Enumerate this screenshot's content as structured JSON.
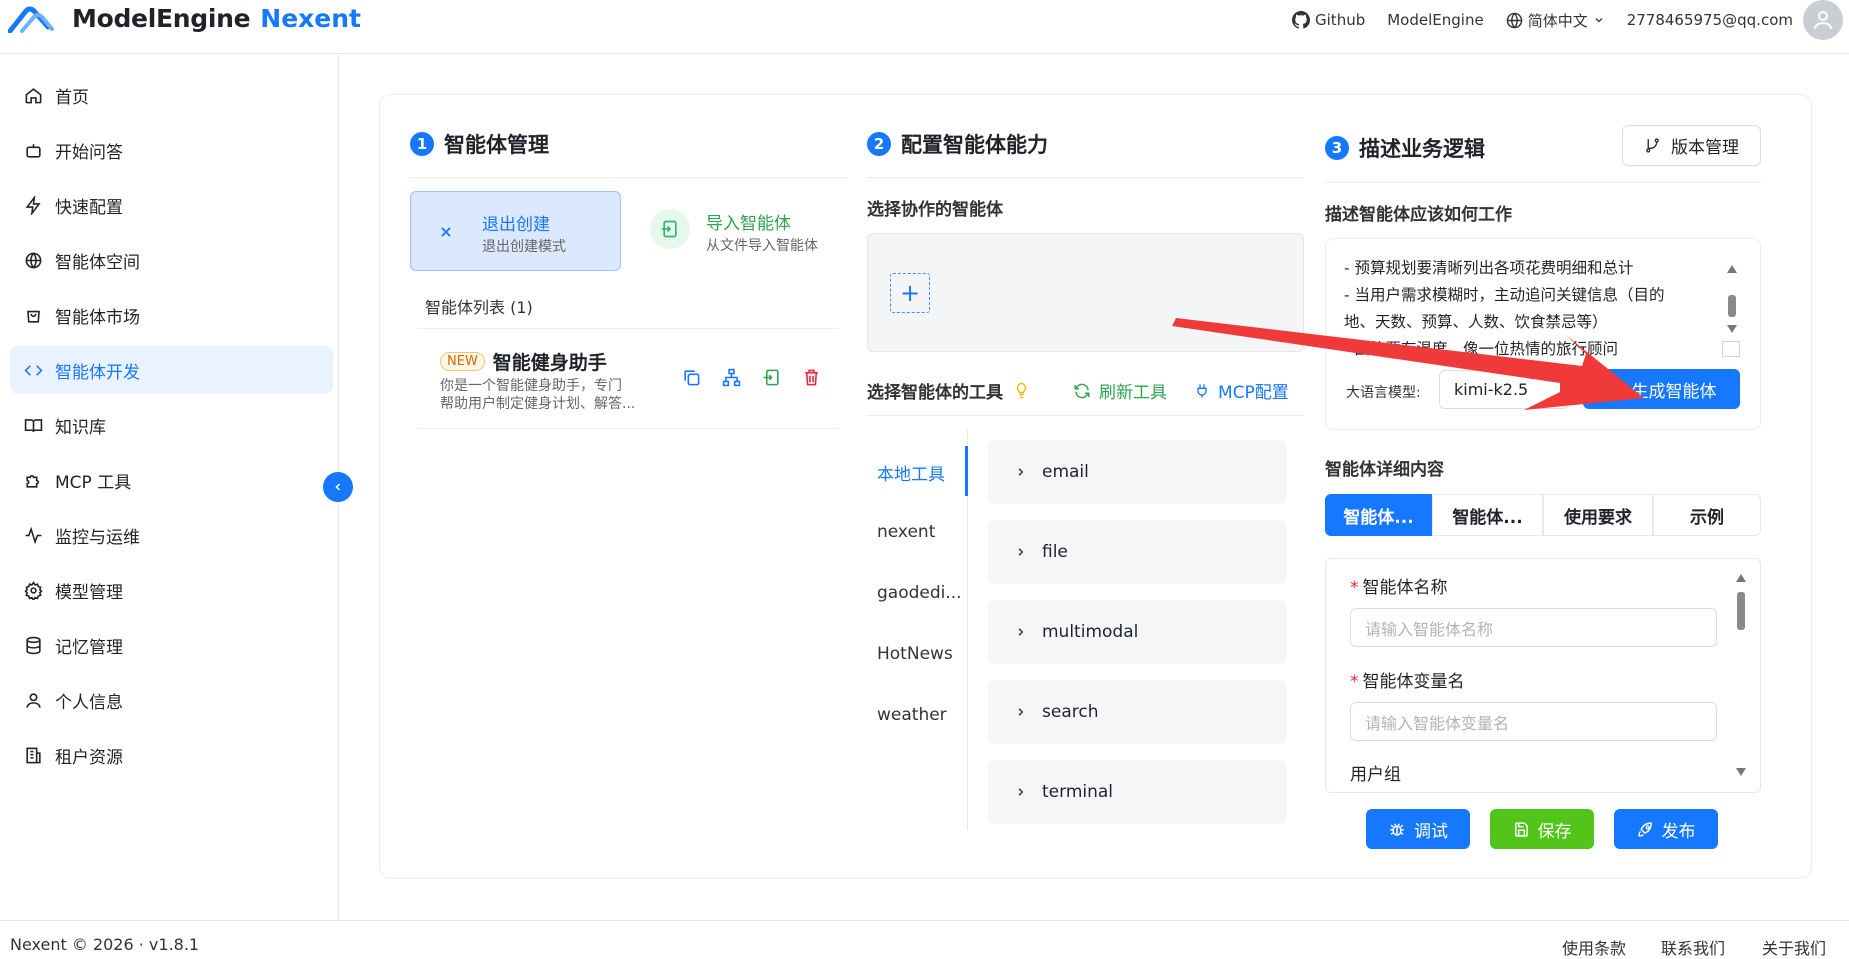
{
  "header": {
    "brand_main": "ModelEngine",
    "brand_accent": "Nexent",
    "github_label": "Github",
    "modelengine_label": "ModelEngine",
    "language_label": "简体中文",
    "user_email": "2778465975@qq.com"
  },
  "sidebar": {
    "items": [
      {
        "label": "首页",
        "icon": "home-icon"
      },
      {
        "label": "开始问答",
        "icon": "robot-icon"
      },
      {
        "label": "快速配置",
        "icon": "lightning-icon"
      },
      {
        "label": "智能体空间",
        "icon": "globe-icon"
      },
      {
        "label": "智能体市场",
        "icon": "shopping-bag-icon"
      },
      {
        "label": "智能体开发",
        "icon": "code-icon"
      },
      {
        "label": "知识库",
        "icon": "book-icon"
      },
      {
        "label": "MCP 工具",
        "icon": "puzzle-icon"
      },
      {
        "label": "监控与运维",
        "icon": "activity-icon"
      },
      {
        "label": "模型管理",
        "icon": "gear-icon"
      },
      {
        "label": "记忆管理",
        "icon": "database-icon"
      },
      {
        "label": "个人信息",
        "icon": "user-icon"
      },
      {
        "label": "租户资源",
        "icon": "building-icon"
      }
    ],
    "active_index": 5
  },
  "section1": {
    "num": "1",
    "title": "智能体管理",
    "exit_title": "退出创建",
    "exit_sub": "退出创建模式",
    "import_title": "导入智能体",
    "import_sub": "从文件导入智能体",
    "list_title": "智能体列表 (1)",
    "agents": [
      {
        "tag": "NEW",
        "name": "智能健身助手",
        "desc_line1": "你是一个智能健身助手，专门",
        "desc_line2": "帮助用户制定健身计划、解答..."
      }
    ]
  },
  "section2": {
    "num": "2",
    "title": "配置智能体能力",
    "collab_label": "选择协作的智能体",
    "tools_label": "选择智能体的工具",
    "refresh_label": "刷新工具",
    "mcp_label": "MCP配置",
    "tool_tabs": [
      "本地工具",
      "nexent",
      "gaodedi...",
      "HotNews",
      "weather"
    ],
    "active_tab_index": 0,
    "tool_groups": [
      "email",
      "file",
      "multimodal",
      "search",
      "terminal"
    ]
  },
  "section3": {
    "num": "3",
    "title": "描述业务逻辑",
    "version_label": "版本管理",
    "describe_label": "描述智能体应该如何工作",
    "prompt_lines": [
      "- 预算规划要清晰列出各项花费明细和总计",
      "- 当用户需求模糊时，主动追问关键信息（目的",
      "地、天数、预算、人数、饮食禁忌等）",
      "- 回答要有温度，像一位热情的旅行顾问"
    ],
    "llm_label": "大语言模型:",
    "llm_value": "kimi-k2.5",
    "generate_label": "生成智能体",
    "detail_title": "智能体详细内容",
    "detail_tabs": [
      "智能体...",
      "智能体...",
      "使用要求",
      "示例"
    ],
    "active_detail_tab": 0,
    "form": {
      "name_label": "智能体名称",
      "name_placeholder": "请输入智能体名称",
      "var_label": "智能体变量名",
      "var_placeholder": "请输入智能体变量名",
      "group_label": "用户组"
    },
    "debug_label": "调试",
    "save_label": "保存",
    "publish_label": "发布"
  },
  "footer": {
    "copyright": "Nexent © 2026 · v1.8.1",
    "terms": "使用条款",
    "contact": "联系我们",
    "about": "关于我们"
  },
  "colors": {
    "primary": "#1677ff",
    "success": "#52c41a",
    "danger": "#f5222d",
    "annotation_arrow": "#f03a3a"
  }
}
